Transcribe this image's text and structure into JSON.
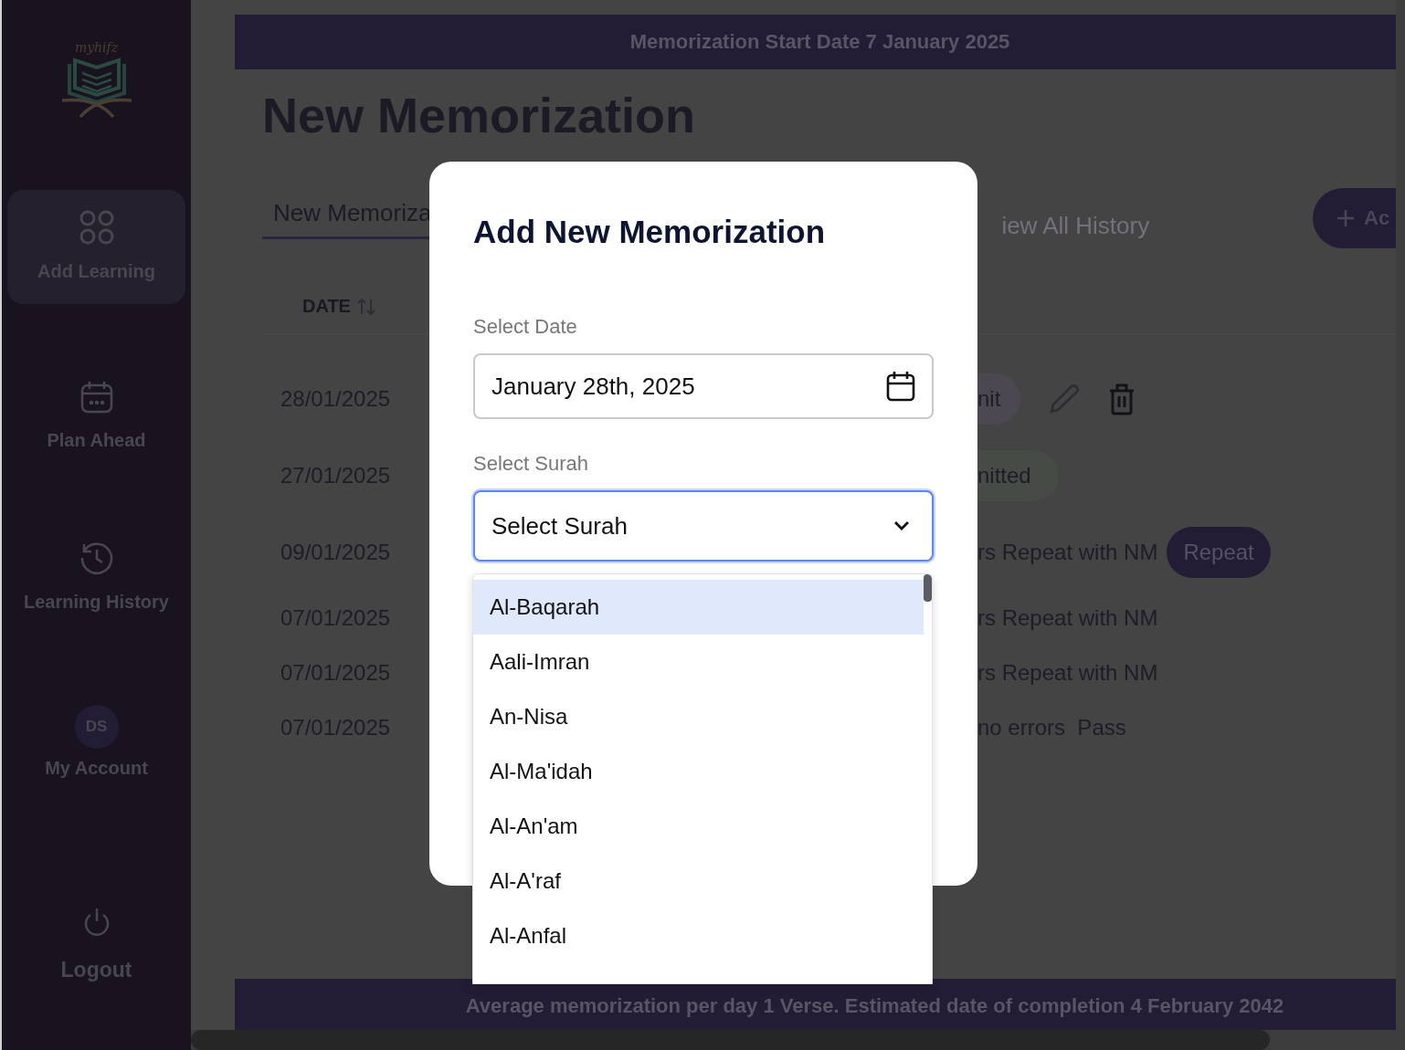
{
  "sidebar": {
    "logo_text": "myhifz",
    "items": [
      {
        "label": "Add Learning",
        "kind": "grid",
        "selected": true
      },
      {
        "label": "Plan Ahead",
        "kind": "calendar",
        "selected": false
      },
      {
        "label": "Learning History",
        "kind": "history",
        "selected": false
      },
      {
        "label": "My Account",
        "kind": "avatar",
        "initials": "DS",
        "selected": false
      },
      {
        "label": "Logout",
        "kind": "power",
        "selected": false
      }
    ]
  },
  "top_banner": "Memorization Start Date 7 January 2025",
  "page_title": "New Memorization",
  "tabs": [
    {
      "label": "New Memoriza",
      "selected": true
    },
    {
      "label": "iew All History",
      "selected": false
    }
  ],
  "add_button": {
    "label": "Ac"
  },
  "table": {
    "columns": [
      "DATE"
    ],
    "rows": [
      {
        "date": "28/01/2025",
        "badge": {
          "text": "nit",
          "kind": "chip"
        },
        "actions": true
      },
      {
        "date": "27/01/2025",
        "badge": {
          "text": "nitted",
          "kind": "success"
        },
        "actions": false
      },
      {
        "date": "09/01/2025",
        "note": "rs Repeat with NM",
        "badge": {
          "text": "Repeat",
          "kind": "button"
        },
        "actions": false
      },
      {
        "date": "07/01/2025",
        "note": "rs Repeat with NM",
        "actions": false
      },
      {
        "date": "07/01/2025",
        "note": "rs Repeat with NM",
        "actions": false
      },
      {
        "date": "07/01/2025",
        "note": "no errors  Pass",
        "actions": false
      }
    ]
  },
  "bottom_banner": "Average memorization per day 1 Verse. Estimated date of completion 4 February 2042",
  "modal": {
    "title": "Add New Memorization",
    "date_field": {
      "label": "Select Date",
      "value": "January 28th, 2025"
    },
    "surah_field": {
      "label": "Select Surah",
      "value": "Select Surah",
      "focused": true
    },
    "options": [
      {
        "label": "Al-Baqarah",
        "selected": true
      },
      {
        "label": "Aali-Imran",
        "selected": false
      },
      {
        "label": "An-Nisa",
        "selected": false
      },
      {
        "label": "Al-Ma'idah",
        "selected": false
      },
      {
        "label": "Al-An'am",
        "selected": false
      },
      {
        "label": "Al-A'raf",
        "selected": false
      },
      {
        "label": "Al-Anfal",
        "selected": false
      }
    ]
  }
}
